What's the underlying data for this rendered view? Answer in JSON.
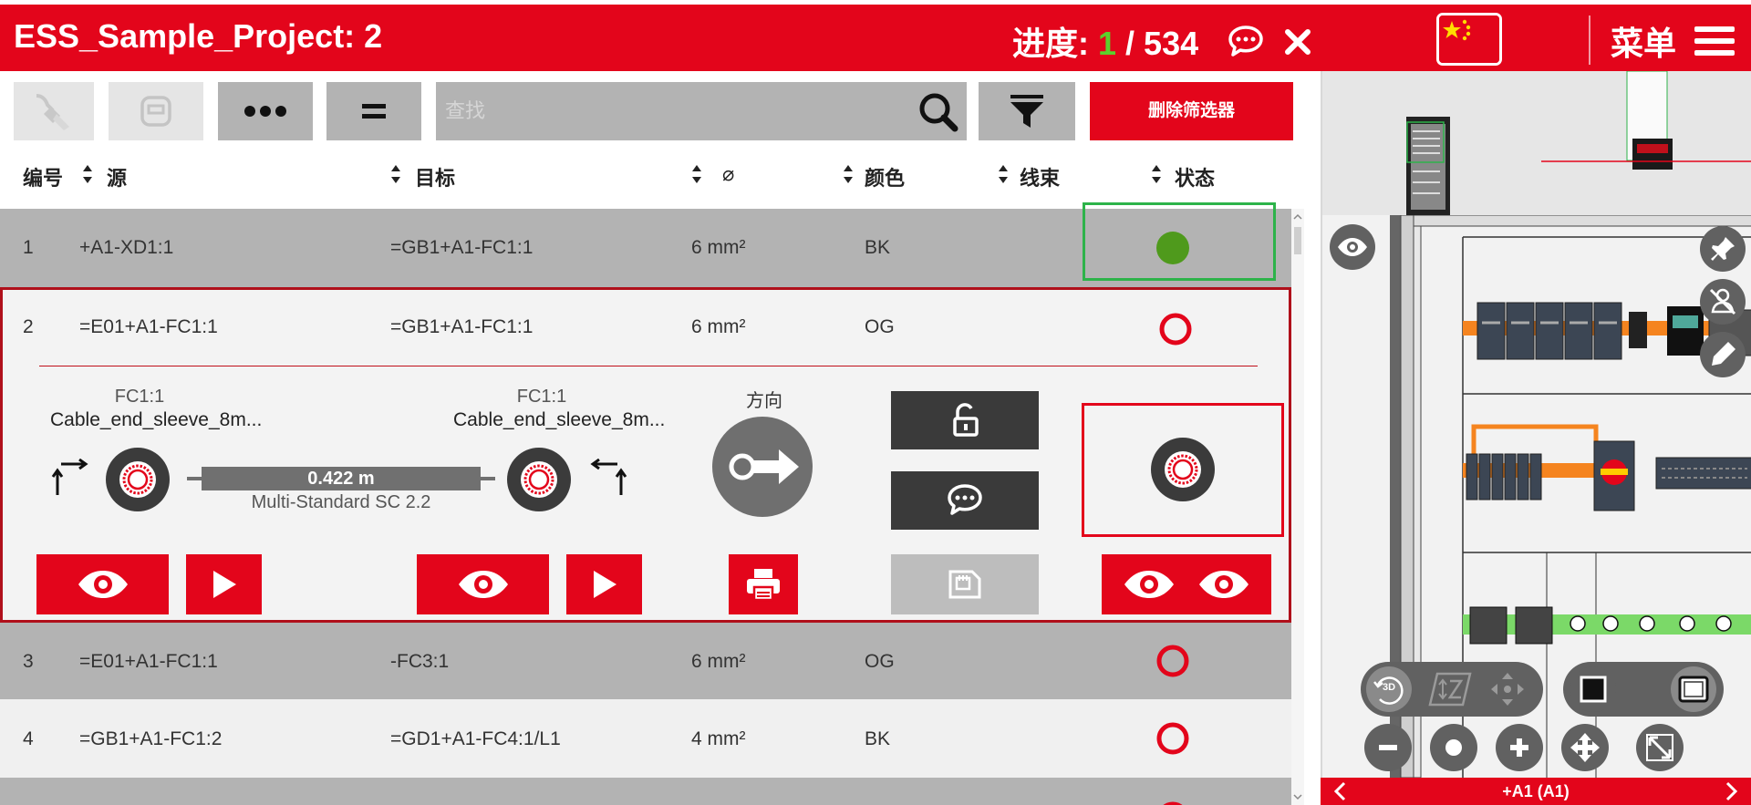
{
  "header": {
    "project_title": "ESS_Sample_Project: 2",
    "progress_label": "进度: ",
    "progress_current": "1",
    "progress_sep": " / ",
    "progress_total": "534",
    "menu_label": "菜单"
  },
  "toolbar": {
    "search_placeholder": "查找",
    "clear_filter_label": "删除筛选器"
  },
  "columns": {
    "number": "编号",
    "source": "源",
    "target": "目标",
    "diameter": "⌀",
    "color": "颜色",
    "bundle": "线束",
    "status": "状态"
  },
  "rows": [
    {
      "number": "1",
      "source": "+A1-XD1:1",
      "target": "=GB1+A1-FC1:1",
      "diameter": "6 mm²",
      "color": "BK",
      "status": "done"
    },
    {
      "number": "2",
      "source": "=E01+A1-FC1:1",
      "target": "=GB1+A1-FC1:1",
      "diameter": "6 mm²",
      "color": "OG",
      "status": "open"
    },
    {
      "number": "3",
      "source": "=E01+A1-FC1:1",
      "target": "-FC3:1",
      "diameter": "6 mm²",
      "color": "OG",
      "status": "open"
    },
    {
      "number": "4",
      "source": "=GB1+A1-FC1:2",
      "target": "=GD1+A1-FC4:1/L1",
      "diameter": "4 mm²",
      "color": "BK",
      "status": "open"
    }
  ],
  "detail": {
    "source_terminal": "FC1:1",
    "source_part": "Cable_end_sleeve_8m...",
    "target_terminal": "FC1:1",
    "target_part": "Cable_end_sleeve_8m...",
    "length": "0.422 m",
    "wire_type": "Multi-Standard SC 2.2",
    "direction_label": "方向"
  },
  "viewer": {
    "location_label": "+A1 (A1)",
    "view3d_label": "3D"
  },
  "colors": {
    "brand_red": "#e3051b",
    "done_green": "#4f9a1c",
    "progress_green": "#5bd12c",
    "highlight_green": "#2db34a"
  }
}
